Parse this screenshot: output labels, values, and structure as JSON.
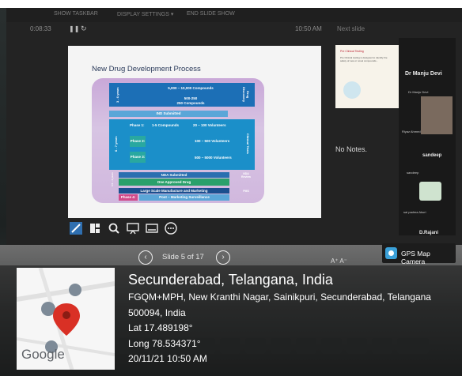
{
  "presenter": {
    "topbar": {
      "item1": "SHOW TASKBAR",
      "item2": "DISPLAY SETTINGS ▾",
      "item3": "END SLIDE SHOW"
    },
    "timer": "0:08:33",
    "clock": "10:50 AM",
    "next_label": "Next slide",
    "no_notes": "No Notes.",
    "slide_label": "Slide 5 of 17",
    "prev_icon": "chevron-left-icon",
    "next_icon": "chevron-right-icon"
  },
  "slide": {
    "title": "New Drug Development Process",
    "rows": [
      {
        "side": "3 - 6 years",
        "left": "",
        "mid": "5,000 – 10,000 Compounds",
        "right": "Drug Discovery"
      },
      {
        "left": "",
        "mid": "250 Compounds",
        "top": "500-250"
      },
      {
        "left": "IND Submitted"
      },
      {
        "side": "6 - 7 years",
        "left": "Phase 1:",
        "mid": "1-5 Compounds",
        "right2": "20 – 100 Volunteers",
        "right": "Clinical Trials"
      },
      {
        "left": "Phase 2:",
        "right2": "100 – 500 Volunteers"
      },
      {
        "left": "Phase 3:",
        "right2": "500 – 5000 Volunteers"
      },
      {
        "left": "NDA Submitted",
        "right": "NDA Review"
      },
      {
        "side": "0.5 – 2 years",
        "mid": "One Approved Drug"
      },
      {
        "mid": "Large Scale Manufacture and Marketing",
        "right": "PMS"
      },
      {
        "left": "Phase 4:",
        "mid": "Post – Marketing Surveillance"
      }
    ]
  },
  "next_slide": {
    "title": "Pre Clinical Testing",
    "body": "Pre Clinical testing is designed to identify the safety of new or novel compounds..."
  },
  "participants": [
    {
      "name": "Dr Manju Devi",
      "sub": "Dr Manju Devi"
    },
    {
      "name": "Riyaz Ahmed"
    },
    {
      "name": "sandeep",
      "sub": "sandeep"
    },
    {
      "name": "sai padma Akuri"
    },
    {
      "name": "D.Rajani",
      "sub": "D.Rajani"
    }
  ],
  "gps": {
    "badge": "GPS Map Camera",
    "city": "Secunderabad, Telangana, India",
    "address1": "FGQM+MPH, New Kranthi Nagar, Sainikpuri, Secunderabad, Telangana",
    "address2": "500094, India",
    "lat": "Lat 17.489198°",
    "long": "Long 78.534371°",
    "datetime": "20/11/21 10:50 AM",
    "map_brand": "Google"
  },
  "colors": {
    "accent_pin": "#d93025",
    "slide_blue": "#1b8fc9",
    "slide_teal": "#29a8a0"
  }
}
